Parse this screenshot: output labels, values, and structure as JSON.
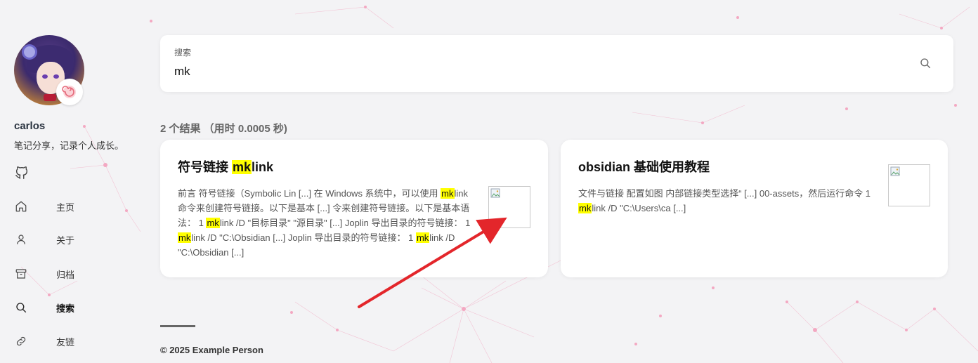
{
  "author": {
    "name": "carlos",
    "description": "笔记分享，记录个人成长。"
  },
  "nav": {
    "items": [
      {
        "label": "主页",
        "icon": "home-icon"
      },
      {
        "label": "关于",
        "icon": "user-icon"
      },
      {
        "label": "归档",
        "icon": "archive-icon"
      },
      {
        "label": "搜索",
        "icon": "search-icon",
        "active": true
      },
      {
        "label": "友链",
        "icon": "link-icon"
      }
    ]
  },
  "search": {
    "label": "搜索",
    "value": "mk"
  },
  "results": {
    "summary": "2 个结果 （用时 0.0005 秒)",
    "items": [
      {
        "title_pre": "符号链接 ",
        "title_mark": "mk",
        "title_post": "link",
        "excerpt": [
          {
            "t": "前言 符号链接（Symbolic Lin [...] 在 Windows 系统中，可以使用 "
          },
          {
            "m": "mk"
          },
          {
            "t": "link 命令来创建符号链接。以下是基本 [...] 令来创建符号链接。以下是基本语法： 1 "
          },
          {
            "m": "mk"
          },
          {
            "t": "link /D \"目标目录\" \"源目录\" [...] Joplin 导出目录的符号链接： 1 "
          },
          {
            "m": "mk"
          },
          {
            "t": "link /D \"C:\\Obsidian [...] Joplin 导出目录的符号链接： 1 "
          },
          {
            "m": "mk"
          },
          {
            "t": "link /D \"C:\\Obsidian [...]"
          }
        ]
      },
      {
        "title_pre": "obsidian 基础使用教程",
        "title_mark": "",
        "title_post": "",
        "excerpt": [
          {
            "t": "文件与链接 配置如图 内部链接类型选择“ [...] 00-assets，然后运行命令 1 "
          },
          {
            "m": "mk"
          },
          {
            "t": "link /D \"C:\\Users\\ca [...]"
          }
        ]
      }
    ]
  },
  "footer": {
    "copyright": "© 2025 Example Person"
  },
  "colors": {
    "highlight": "#ffff00",
    "arrow": "#e3262b",
    "network": "#f0a5c0"
  }
}
